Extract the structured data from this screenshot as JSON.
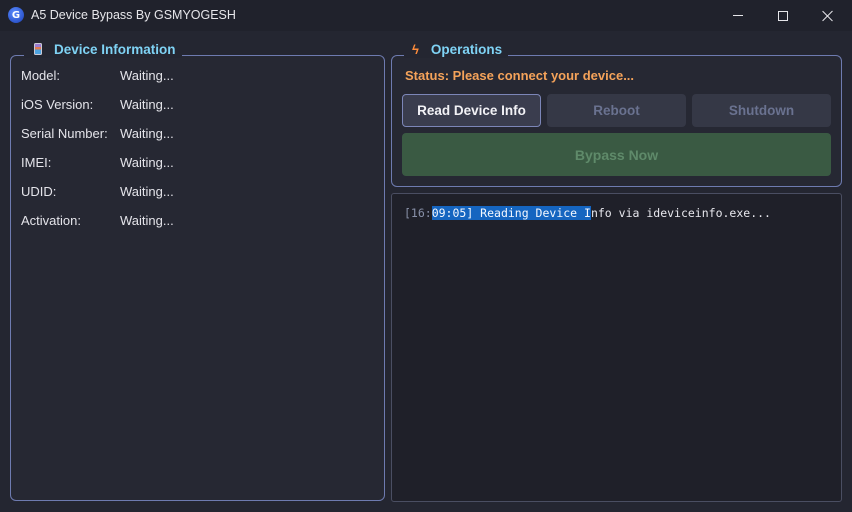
{
  "window": {
    "title": "A5 Device Bypass By GSMYOGESH",
    "icon_letter": "G"
  },
  "device_info": {
    "legend": "Device Information",
    "rows": [
      {
        "label": "Model:",
        "value": "Waiting..."
      },
      {
        "label": "iOS Version:",
        "value": "Waiting..."
      },
      {
        "label": "Serial Number:",
        "value": "Waiting..."
      },
      {
        "label": "IMEI:",
        "value": "Waiting..."
      },
      {
        "label": "UDID:",
        "value": "Waiting..."
      },
      {
        "label": "Activation:",
        "value": "Waiting..."
      }
    ]
  },
  "operations": {
    "legend": "Operations",
    "status": "Status: Please connect your device...",
    "buttons": {
      "read": "Read Device Info",
      "reboot": "Reboot",
      "shutdown": "Shutdown",
      "bypass": "Bypass Now"
    }
  },
  "log": {
    "prefix": "[16:",
    "selected": "09:05] Reading Device I",
    "rest": "nfo via ideviceinfo.exe..."
  },
  "colors": {
    "accent": "#7fd3f5",
    "status": "#f5a35a",
    "border": "#6e7bb0",
    "selection": "#1565c0",
    "bypass_bg": "#3a5a43"
  }
}
